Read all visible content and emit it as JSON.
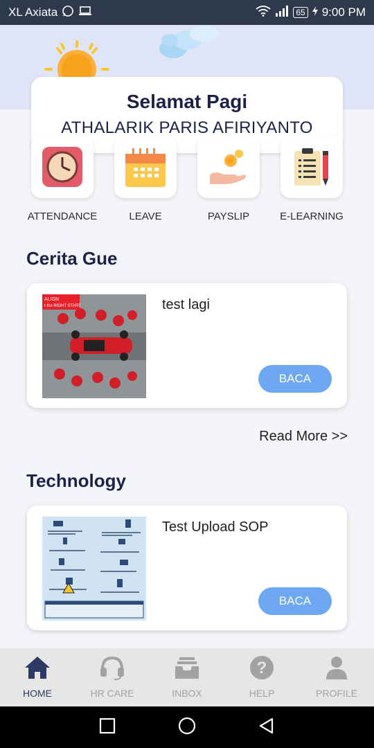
{
  "status_bar": {
    "carrier": "XL Axiata",
    "battery": "65",
    "time": "9:00 PM"
  },
  "greeting": {
    "title": "Selamat Pagi",
    "name": "ATHALARIK PARIS AFIRIYANTO"
  },
  "menu": [
    {
      "label": "ATTENDANCE",
      "icon": "clock-icon"
    },
    {
      "label": "LEAVE",
      "icon": "calendar-icon"
    },
    {
      "label": "PAYSLIP",
      "icon": "coin-hand-icon"
    },
    {
      "label": "E-LEARNING",
      "icon": "clipboard-pen-icon"
    }
  ],
  "sections": [
    {
      "title": "Cerita Gue",
      "card": {
        "title": "test lagi",
        "button": "BACA",
        "thumb_caption_1": "ALIGN",
        "thumb_caption_2": "t the RIGHT START"
      }
    },
    {
      "title": "Technology",
      "card": {
        "title": "Test Upload SOP",
        "button": "BACA"
      }
    }
  ],
  "read_more": "Read More >>",
  "bottom_nav": [
    {
      "label": "HOME",
      "icon": "home-icon",
      "active": true
    },
    {
      "label": "HR CARE",
      "icon": "headset-icon"
    },
    {
      "label": "INBOX",
      "icon": "inbox-icon"
    },
    {
      "label": "HELP",
      "icon": "help-icon"
    },
    {
      "label": "PROFILE",
      "icon": "profile-icon"
    }
  ],
  "colors": {
    "status_bar": "#2e3a4c",
    "hero_bg": "#dfe5f6",
    "title": "#1d2048",
    "button": "#6fa8f2",
    "nav_active": "#2e3a66",
    "nav_inactive": "#a2a2a2"
  }
}
